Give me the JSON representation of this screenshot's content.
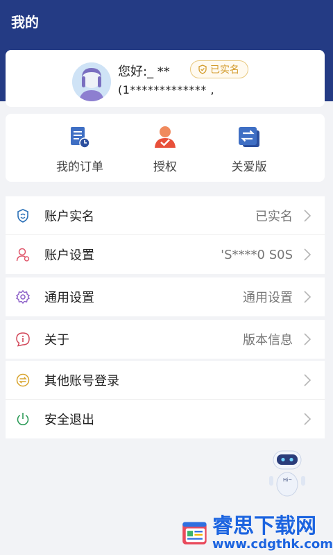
{
  "header": {
    "title": "我的"
  },
  "profile": {
    "greeting": "您好:_ **",
    "verified_badge": "已实名",
    "phone": "(1************* ,"
  },
  "shortcuts": [
    {
      "label": "我的订单",
      "icon": "order-icon"
    },
    {
      "label": "授权",
      "icon": "authorize-icon"
    },
    {
      "label": "关爱版",
      "icon": "care-mode-icon"
    }
  ],
  "menu_groups": [
    [
      {
        "label": "账户实名",
        "value": "已实名",
        "icon": "shield-icon"
      },
      {
        "label": "账户设置",
        "value": "'S****0 S0S",
        "icon": "user-settings-icon"
      }
    ],
    [
      {
        "label": "通用设置",
        "value": "通用设置",
        "icon": "gear-icon"
      }
    ],
    [
      {
        "label": "关于",
        "value": "版本信息",
        "icon": "info-icon"
      }
    ],
    [
      {
        "label": "其他账号登录",
        "value": "",
        "icon": "switch-account-icon"
      },
      {
        "label": "安全退出",
        "value": "",
        "icon": "power-icon"
      }
    ]
  ],
  "assistant": {
    "badge": "Hi~"
  },
  "watermark": {
    "title": "睿思下载网",
    "url": "www.cdgthk.com"
  },
  "colors": {
    "header": "#243b84",
    "accent_gold": "#d39b2b",
    "watermark_blue": "#1c64e0"
  }
}
